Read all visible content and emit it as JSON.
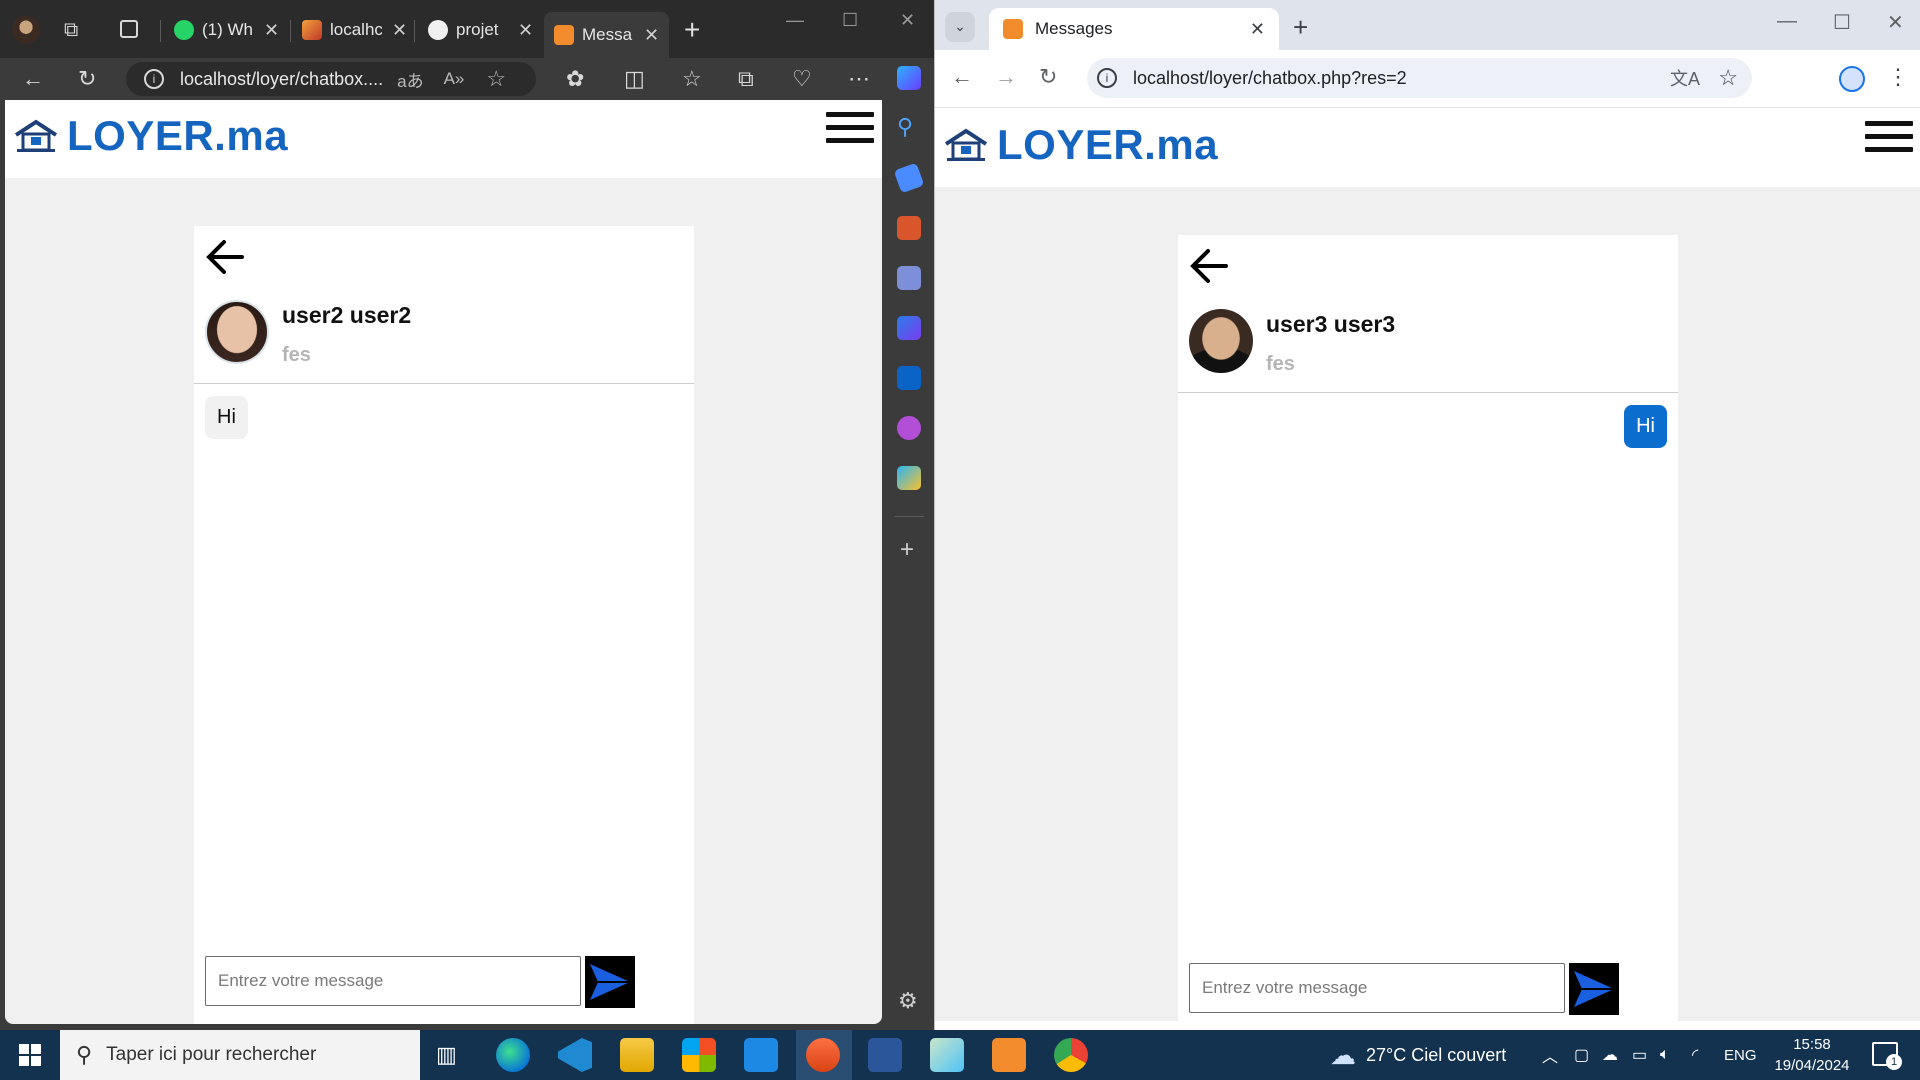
{
  "edge": {
    "tabs": [
      {
        "label": "(1) Wh",
        "color": "#25d366"
      },
      {
        "label": "localhc",
        "color": "#d9a441"
      },
      {
        "label": "projet",
        "color": "#f0f0f0"
      },
      {
        "label": "Messa",
        "color": "#f28b2c"
      }
    ],
    "url": "localhost/loyer/chatbox...."
  },
  "chrome": {
    "tab_title": "Messages",
    "url": "localhost/loyer/chatbox.php?res=2"
  },
  "site": {
    "logo_text": "LOYER.ma",
    "brand_color": "#1565c0"
  },
  "left_chat": {
    "user_name": "user2 user2",
    "user_city": "fes",
    "message": "Hi",
    "placeholder": "Entrez votre message"
  },
  "right_chat": {
    "user_name": "user3 user3",
    "user_city": "fes",
    "message": "Hi",
    "placeholder": "Entrez votre message",
    "sent_color": "#0b6ecf"
  },
  "taskbar": {
    "search_placeholder": "Taper ici pour rechercher",
    "weather": "27°C  Ciel couvert",
    "language": "ENG",
    "time": "15:58",
    "date": "19/04/2024",
    "notification_count": "1"
  }
}
